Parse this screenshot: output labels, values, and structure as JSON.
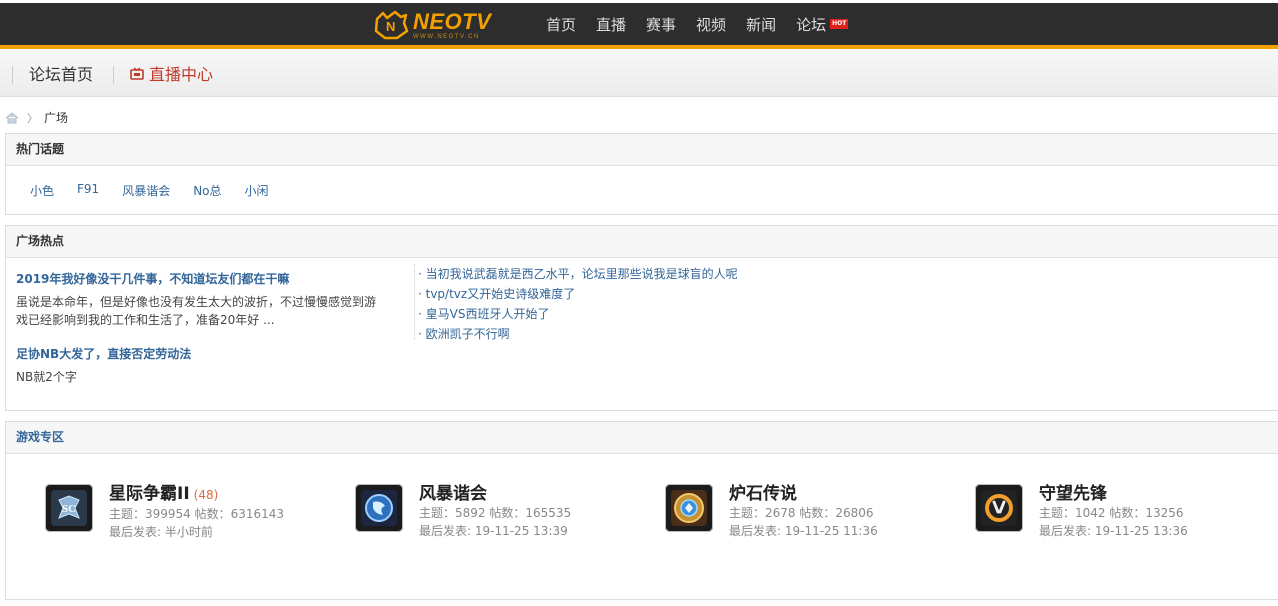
{
  "header": {
    "logo_name": "NEOTV",
    "logo_url": "WWW.NEOTV.CN",
    "nav": [
      {
        "label": "首页"
      },
      {
        "label": "直播"
      },
      {
        "label": "赛事"
      },
      {
        "label": "视频"
      },
      {
        "label": "新闻"
      },
      {
        "label": "论坛",
        "badge": "HOT"
      }
    ]
  },
  "subbar": {
    "forum_home": "论坛首页",
    "live_center": "直播中心"
  },
  "breadcrumb": {
    "current": "广场"
  },
  "hot_topics": {
    "title": "热门话题",
    "tags": [
      "小色",
      "F91",
      "风暴谐会",
      "No总",
      "小闲"
    ]
  },
  "plaza_hot": {
    "title": "广场热点",
    "featured": [
      {
        "title": "2019年我好像没干几件事，不知道坛友们都在干嘛",
        "desc": "虽说是本命年，但是好像也没有发生太大的波折，不过慢慢感觉到游戏已经影响到我的工作和生活了，准备20年好 ..."
      },
      {
        "title": "足协NB大发了，直接否定劳动法",
        "desc": "NB就2个字"
      }
    ],
    "links": [
      "· 当初我说武磊就是西乙水平，论坛里那些说我是球盲的人呢",
      "· tvp/tvz又开始史诗级难度了",
      "· 皇马VS西班牙人开始了",
      "· 欧洲凯子不行啊"
    ]
  },
  "game_zone": {
    "title": "游戏专区",
    "games": [
      {
        "name": "星际争霸II",
        "today": "(48)",
        "stats": "主题：399954 帖数：6316143",
        "last": "最后发表: 半小时前",
        "icon": "starcraft2-icon"
      },
      {
        "name": "风暴谐会",
        "today": "",
        "stats": "主题：5892 帖数：165535",
        "last": "最后发表: 19-11-25 13:39",
        "icon": "heroes-storm-icon"
      },
      {
        "name": "炉石传说",
        "today": "",
        "stats": "主题：2678 帖数：26806",
        "last": "最后发表: 19-11-25 11:36",
        "icon": "hearthstone-icon"
      },
      {
        "name": "守望先锋",
        "today": "",
        "stats": "主题：1042 帖数：13256",
        "last": "最后发表: 19-11-25 13:36",
        "icon": "overwatch-icon"
      }
    ]
  },
  "colors": {
    "topbar": "#2d2d2d",
    "accent": "#f4a100",
    "link": "#336699",
    "live_red": "#c0392b"
  }
}
